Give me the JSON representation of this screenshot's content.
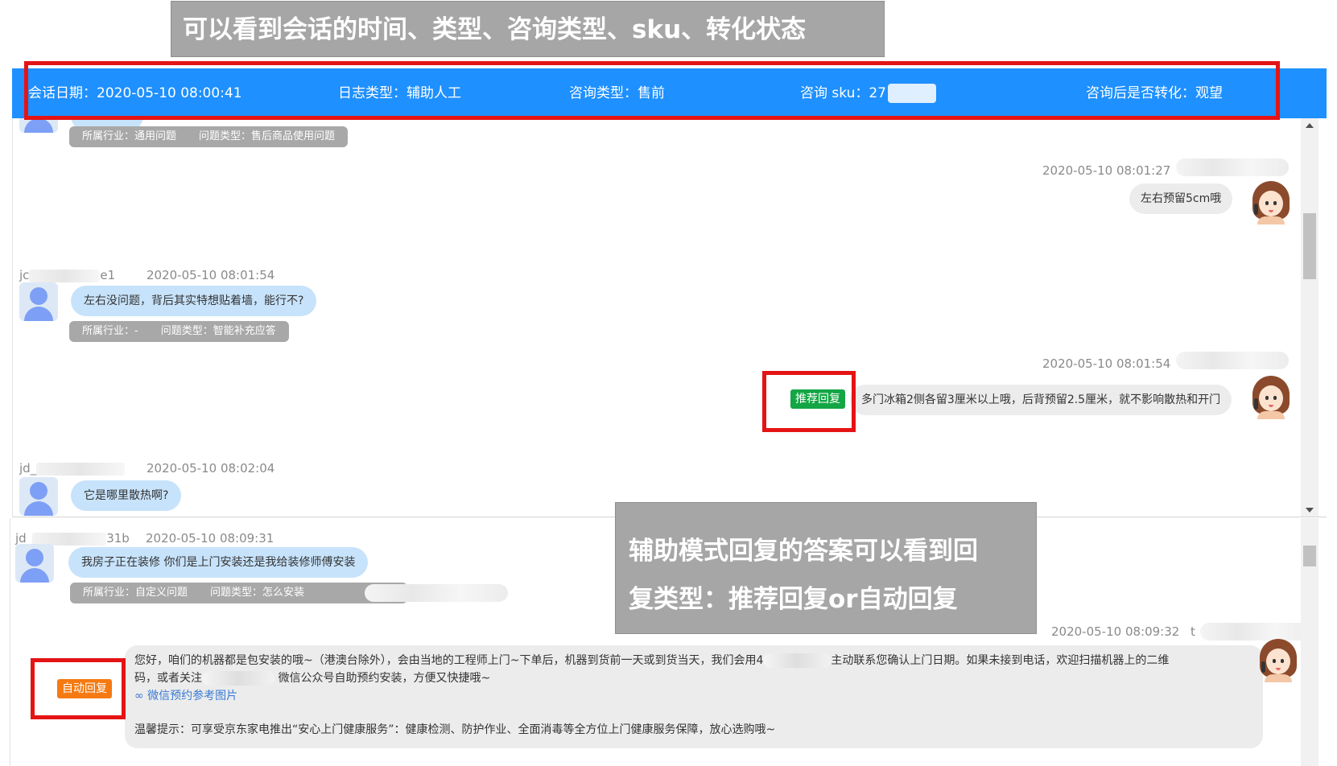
{
  "annotations": {
    "top": "可以看到会话的时间、类型、咨询类型、sku、转化状态",
    "middle_line1": "辅助模式回复的答案可以看到回",
    "middle_line2": "复类型：推荐回复or自动回复"
  },
  "header": {
    "date": "会话日期：2020-05-10 08:00:41",
    "log_type": "日志类型：辅助人工",
    "consult_type": "咨询类型：售前",
    "sku": "咨询 sku：27",
    "conversion": "咨询后是否转化：观望"
  },
  "colors": {
    "header_blue": "#1e90ff",
    "annotation_gray": "#a6a6a6",
    "highlight_red": "#e41414",
    "user_bubble": "#c7e3fb",
    "agent_bubble": "#ececec",
    "badge_recommend": "#14a645",
    "badge_auto": "#f57a12"
  },
  "panel1": {
    "msg0_tags": {
      "industry": "所属行业：通用问题",
      "question": "问题类型：售后商品使用问题"
    },
    "msg1": {
      "time": "2020-05-10 08:01:27",
      "text": "左右预留5cm哦"
    },
    "msg2": {
      "name_prefix": "jc",
      "name_suffix": "e1",
      "time": "2020-05-10 08:01:54",
      "text": "左右没问题，背后其实特想贴着墙，能行不?",
      "industry": "所属行业：-",
      "question": "问题类型：智能补充应答"
    },
    "msg3": {
      "time": "2020-05-10 08:01:54",
      "badge": "推荐回复",
      "text": "多门冰箱2侧各留3厘米以上哦，后背预留2.5厘米，就不影响散热和开门"
    },
    "msg4": {
      "name_prefix": "jd_",
      "time": "2020-05-10 08:02:04",
      "text": "它是哪里散热啊?"
    }
  },
  "panel2": {
    "msg1": {
      "name_prefix": "jd_",
      "name_suffix": "31b",
      "time": "2020-05-10 08:09:31",
      "text": "我房子正在装修 你们是上门安装还是我给装修师傅安装",
      "industry": "所属行业：自定义问题",
      "question": "问题类型：怎么安装"
    },
    "msg2": {
      "time": "2020-05-10 08:09:32",
      "time_suffix": "t",
      "badge": "自动回复",
      "line1a": "您好，咱们的机器都是包安装的哦~（港澳台除外），会由当地的工程师上门~下单后，机器到货前一天或到货当天，我们会用4",
      "line1b": "主动联系您确认上门日期。如果未接到电话，欢迎扫描机器上的二维",
      "line2a": "码，或者关注",
      "line2b": "微信公众号自助预约安装，方便又快捷哦~",
      "link": "∞ 微信预约参考图片",
      "line4": "温馨提示：可享受京东家电推出“安心上门健康服务”：健康检测、防护作业、全面消毒等全方位上门健康服务保障，放心选购哦~"
    }
  }
}
